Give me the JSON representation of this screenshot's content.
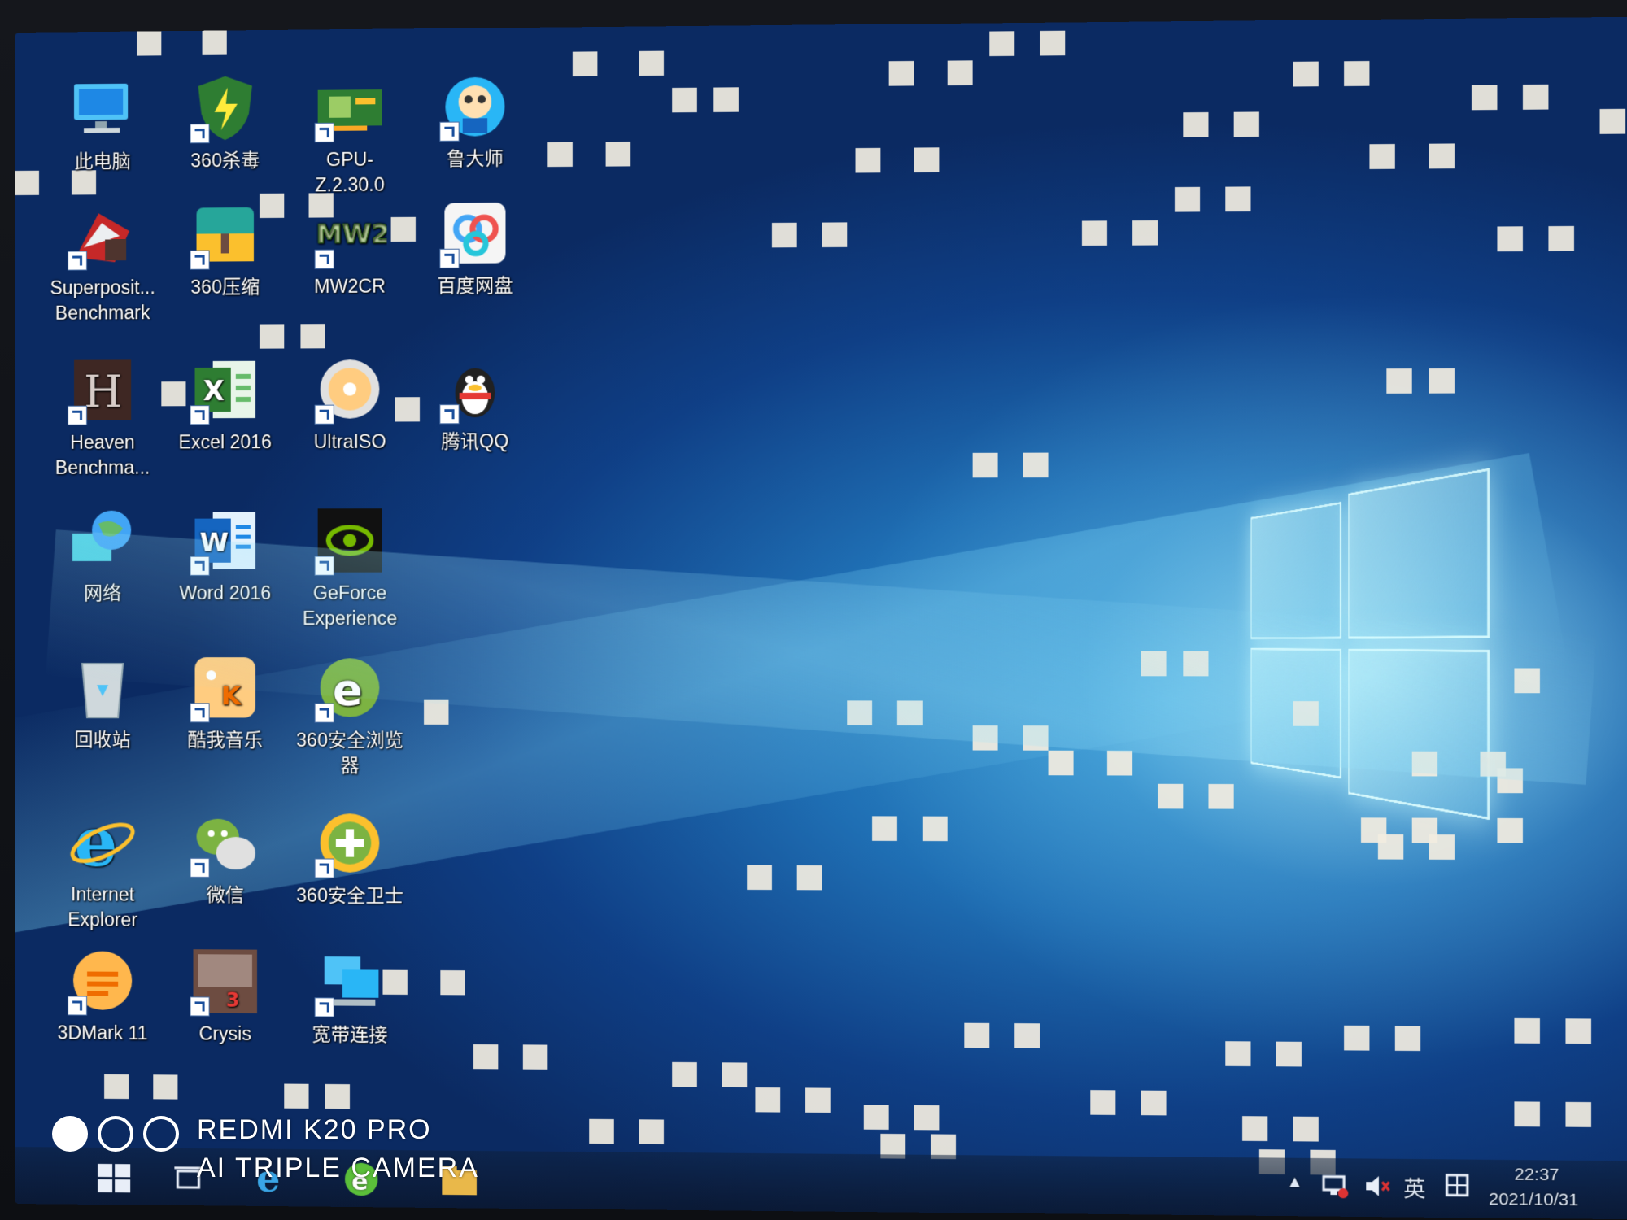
{
  "desktop": {
    "icons": [
      {
        "label": "此电脑",
        "icon": "computer-icon",
        "shortcut": false
      },
      {
        "label": "360杀毒",
        "icon": "360-antivirus-shield-icon",
        "shortcut": true
      },
      {
        "label": "GPU-Z.2.30.0",
        "icon": "gpu-card-icon",
        "shortcut": true
      },
      {
        "label": "鲁大师",
        "icon": "ludashi-icon",
        "shortcut": true
      },
      {
        "label": "Superposit...\nBenchmark",
        "icon": "superposition-benchmark-icon",
        "shortcut": true
      },
      {
        "label": "360压缩",
        "icon": "360-zip-icon",
        "shortcut": true
      },
      {
        "label": "MW2CR",
        "icon": "mw2-game-icon",
        "shortcut": true
      },
      {
        "label": "百度网盘",
        "icon": "baidu-netdisk-icon",
        "shortcut": true
      },
      {
        "label": "Heaven\nBenchma...",
        "icon": "heaven-benchmark-icon",
        "shortcut": true
      },
      {
        "label": "Excel 2016",
        "icon": "excel-icon",
        "shortcut": true
      },
      {
        "label": "UltraISO",
        "icon": "ultraiso-disc-icon",
        "shortcut": true
      },
      {
        "label": "腾讯QQ",
        "icon": "qq-penguin-icon",
        "shortcut": true
      },
      {
        "label": "网络",
        "icon": "network-globe-icon",
        "shortcut": false
      },
      {
        "label": "Word 2016",
        "icon": "word-icon",
        "shortcut": true
      },
      {
        "label": "GeForce\nExperience",
        "icon": "geforce-experience-icon",
        "shortcut": true
      },
      {
        "label": "回收站",
        "icon": "recycle-bin-icon",
        "shortcut": false
      },
      {
        "label": "酷我音乐",
        "icon": "kuwo-music-icon",
        "shortcut": true
      },
      {
        "label": "360安全浏览\n器",
        "icon": "360-browser-icon",
        "shortcut": true
      },
      {
        "label": "Internet\nExplorer",
        "icon": "internet-explorer-icon",
        "shortcut": false
      },
      {
        "label": "微信",
        "icon": "wechat-icon",
        "shortcut": true
      },
      {
        "label": "360安全卫士",
        "icon": "360-security-guard-icon",
        "shortcut": true
      },
      {
        "label": "3DMark 11",
        "icon": "3dmark-icon",
        "shortcut": true
      },
      {
        "label": "Crysis",
        "icon": "crysis-icon",
        "shortcut": true
      },
      {
        "label": "宽带连接",
        "icon": "broadband-connection-icon",
        "shortcut": true
      }
    ]
  },
  "taskbar": {
    "start_icon": "windows-start-icon",
    "task_view_icon": "task-view-icon",
    "pinned": [
      "internet-explorer-icon",
      "360-browser-icon",
      "file-explorer-icon"
    ],
    "tray": {
      "chevron_icon": "chevron-up-icon",
      "network_icon": "network-status-icon",
      "volume_icon": "volume-muted-icon",
      "ime_label": "英",
      "ime_mode_icon": "ime-mode-icon",
      "time": "22:37",
      "date": "2021/10/31"
    }
  },
  "watermark": {
    "line1": "REDMI K20 PRO",
    "line2": "AI TRIPLE CAMERA"
  },
  "colors": {
    "wallpaper_dark": "#0b2a62",
    "wallpaper_mid": "#1f6fb4",
    "wallpaper_light": "#3a9ed7",
    "dead_pixel": "#f1ece0"
  }
}
